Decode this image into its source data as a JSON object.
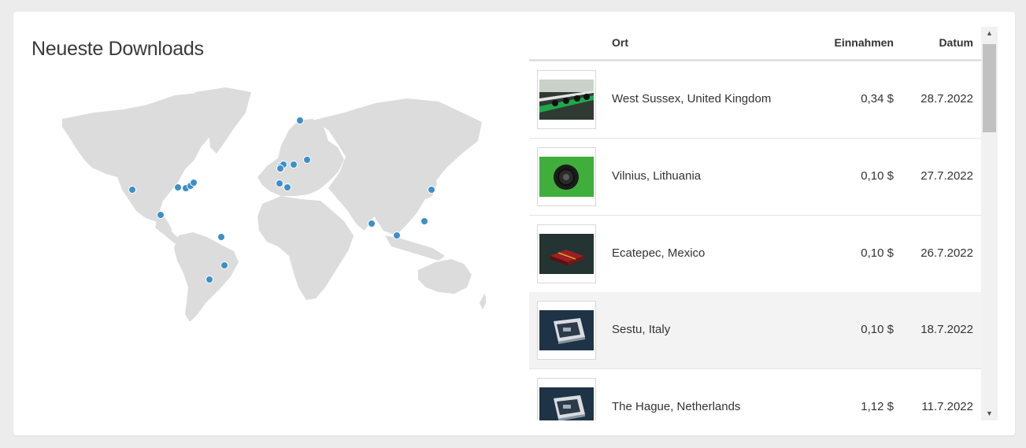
{
  "widget": {
    "title": "Neueste Downloads"
  },
  "colors": {
    "pin": "#3d8fc6",
    "land": "#dcdcdc",
    "highlight_row": "#f3f3f3"
  },
  "table": {
    "headers": {
      "location": "Ort",
      "revenue": "Einnahmen",
      "date": "Datum"
    },
    "rows": [
      {
        "thumb": "bike-rack-photo",
        "location": "West Sussex, United Kingdom",
        "revenue": "0,34 $",
        "date": "28.7.2022"
      },
      {
        "thumb": "camera-lens-green-photo",
        "location": "Vilnius, Lithuania",
        "revenue": "0,10 $",
        "date": "27.7.2022"
      },
      {
        "thumb": "gift-box-dark-photo",
        "location": "Ecatepec, Mexico",
        "revenue": "0,10 $",
        "date": "26.7.2022"
      },
      {
        "thumb": "ssd-drive-photo",
        "location": "Sestu, Italy",
        "revenue": "0,10 $",
        "date": "18.7.2022"
      },
      {
        "thumb": "ssd-drive-photo",
        "location": "The Hague, Netherlands",
        "revenue": "1,12 $",
        "date": "11.7.2022"
      }
    ]
  }
}
